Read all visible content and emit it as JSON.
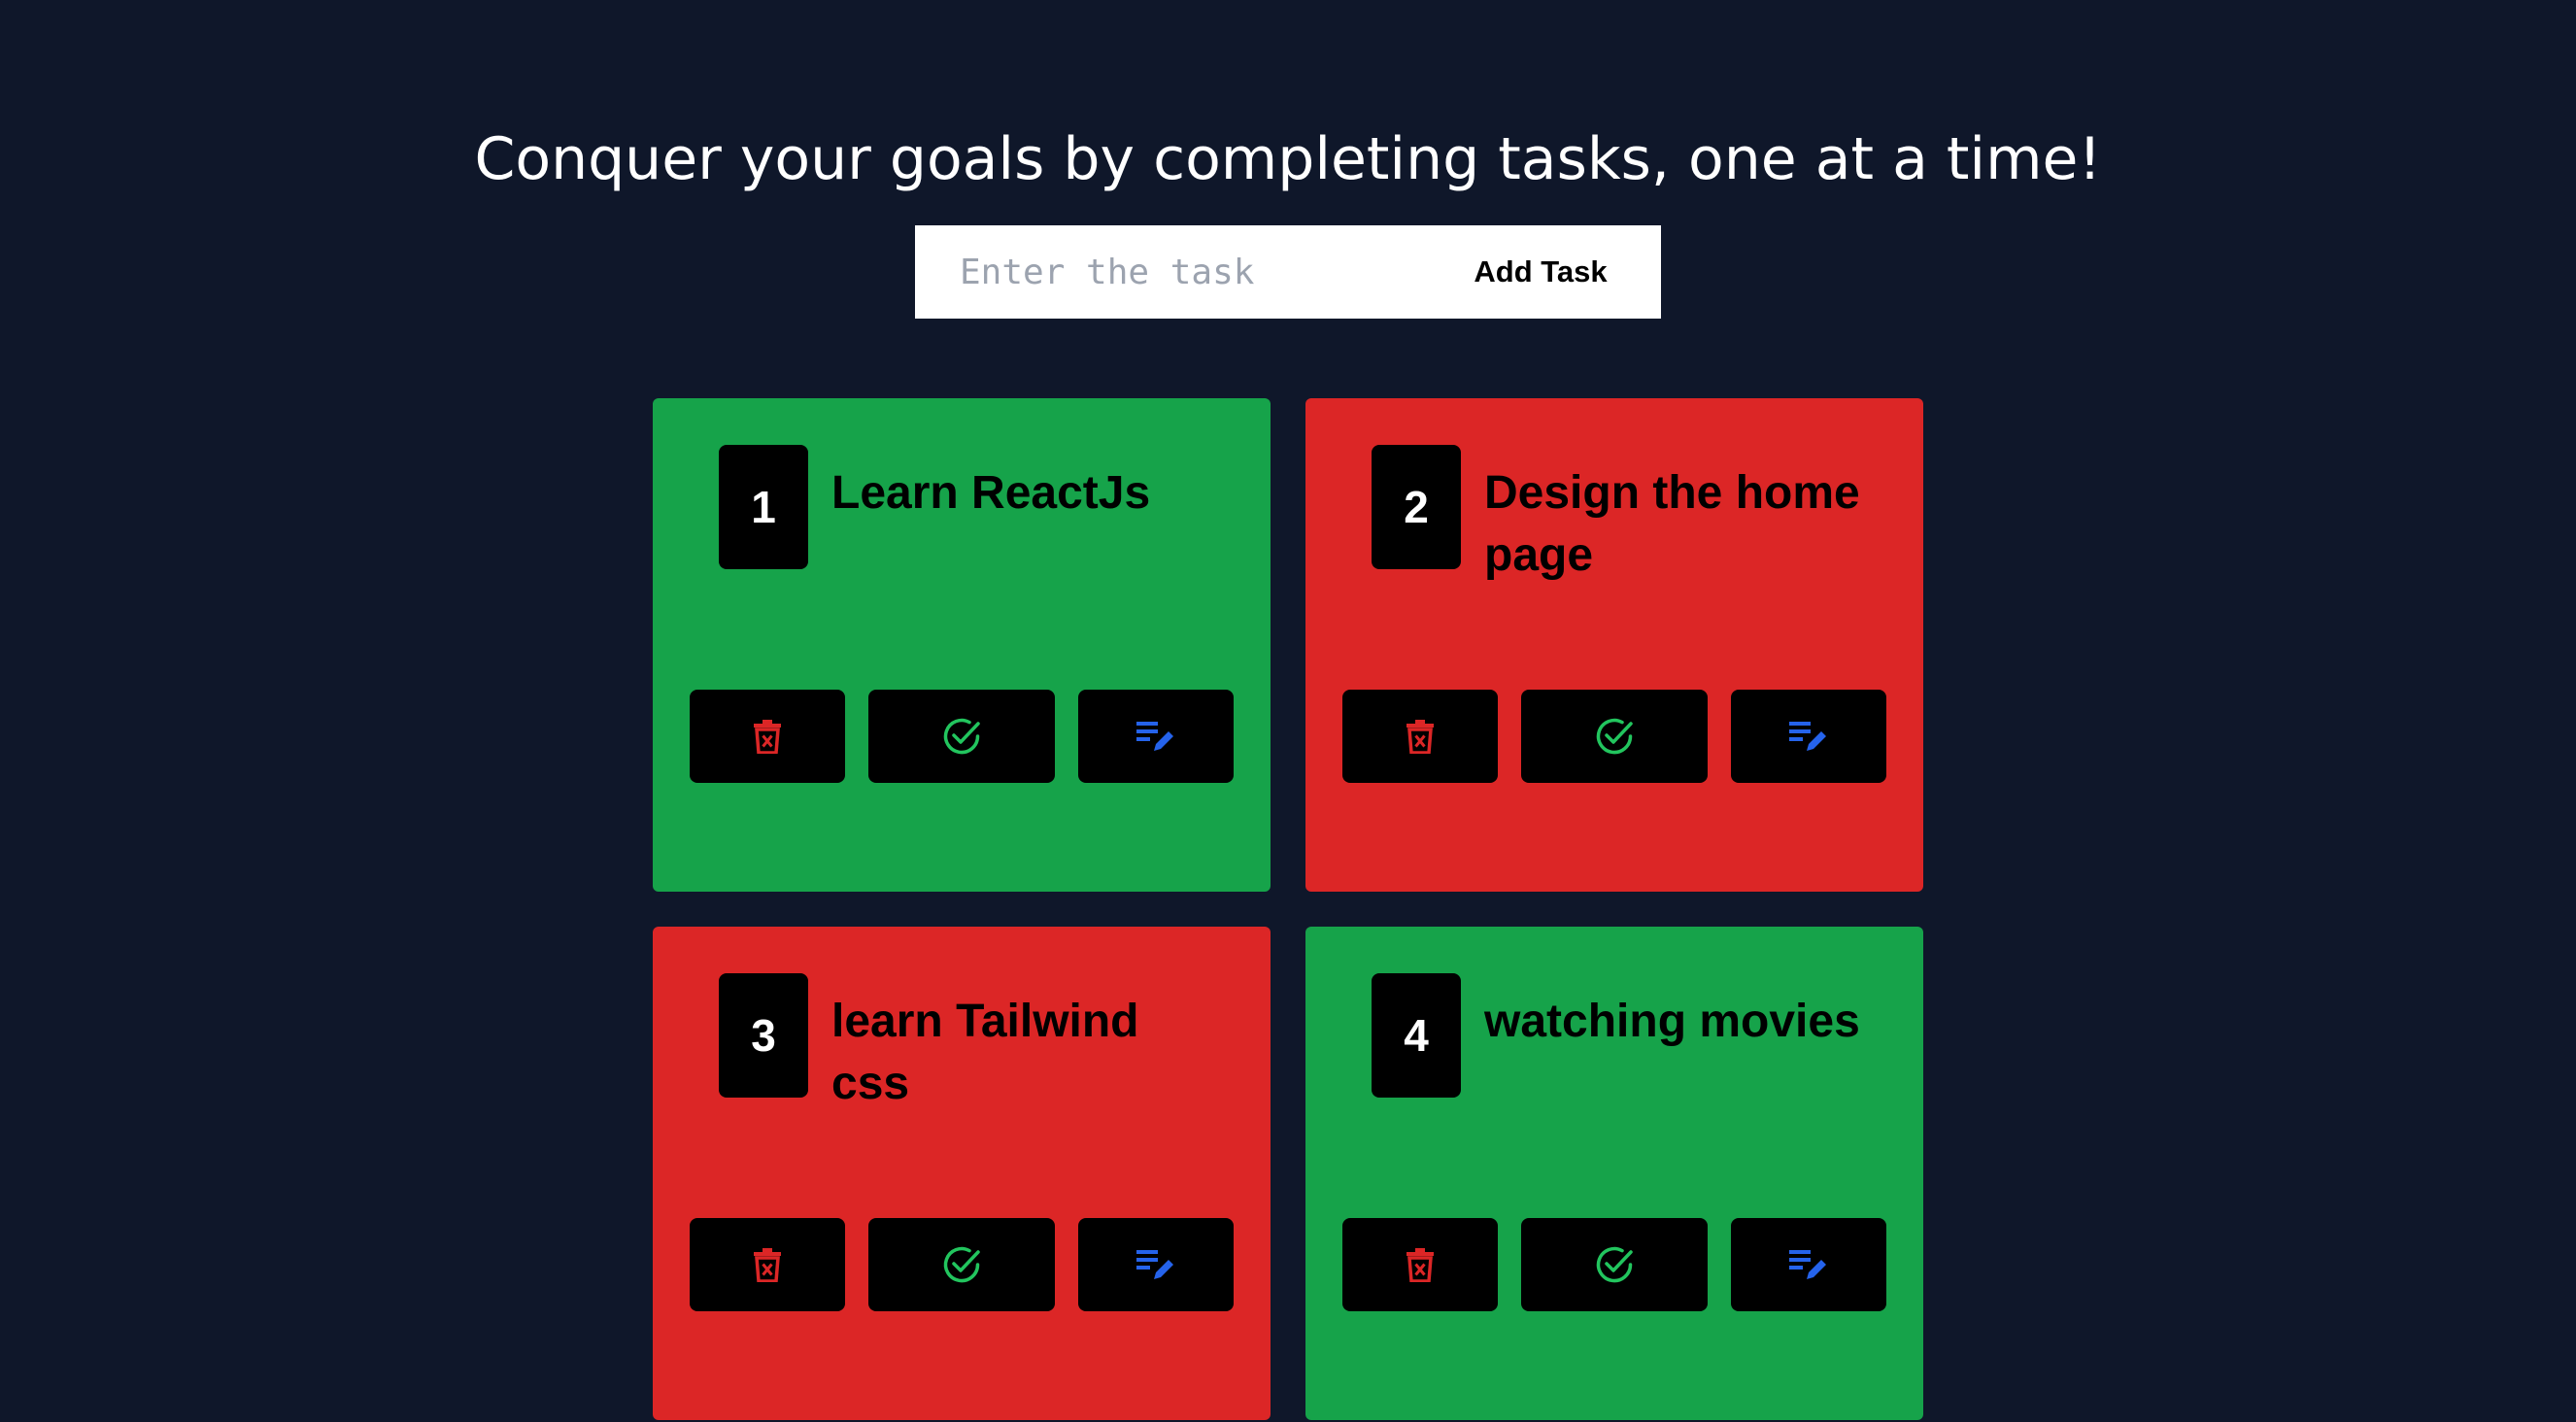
{
  "header": {
    "title": "Conquer your goals by completing tasks, one at a time!"
  },
  "form": {
    "placeholder": "Enter the task",
    "value": "",
    "add_label": "Add Task"
  },
  "colors": {
    "background": "#0f172a",
    "completed": "#16a34a",
    "pending": "#dc2626",
    "delete_icon": "#dc2626",
    "complete_icon": "#22c55e",
    "edit_icon": "#2563eb"
  },
  "tasks": [
    {
      "number": "1",
      "title": "Learn ReactJs",
      "status": "completed"
    },
    {
      "number": "2",
      "title": "Design the home page",
      "status": "pending"
    },
    {
      "number": "3",
      "title": "learn Tailwind css",
      "status": "pending"
    },
    {
      "number": "4",
      "title": "watching movies",
      "status": "completed"
    }
  ],
  "actions": {
    "delete_icon": "trash-x-icon",
    "complete_icon": "check-circle-icon",
    "edit_icon": "edit-note-icon"
  }
}
